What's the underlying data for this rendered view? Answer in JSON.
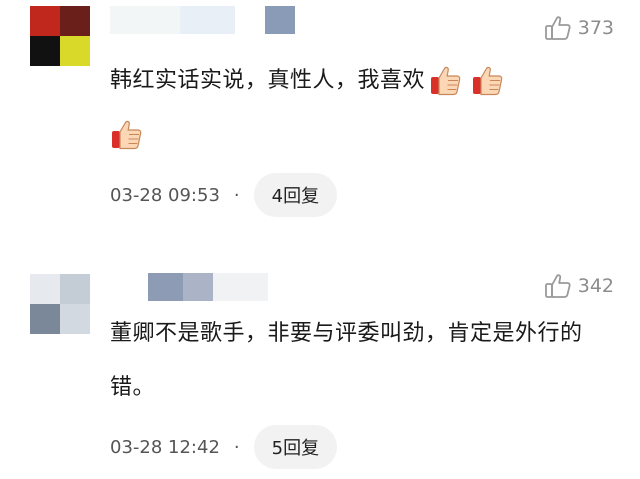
{
  "comments": [
    {
      "likes": "373",
      "text": "韩红实话实说，真性人，我喜欢",
      "time": "03-28 09:53",
      "dot": "·",
      "reply_label": "4回复"
    },
    {
      "likes": "342",
      "text": "董卿不是歌手，非要与评委叫劲，肯定是外行的错。",
      "time": "03-28 12:42",
      "dot": "·",
      "reply_label": "5回复"
    }
  ],
  "icons": {
    "like": "thumbs-up-outline-icon",
    "emoji": "thumbs-up-emoji-icon"
  },
  "colors": {
    "avatar1": [
      "#c0281e",
      "#6b1f1a",
      "#111111",
      "#d9d92a"
    ],
    "avatar2": [
      "#dfe3e8",
      "#b9c1cc",
      "#7a8899",
      "#9aa6b4"
    ],
    "username1": [
      "#eef3f5",
      "#e6eef6",
      "#8a9bb8"
    ],
    "username2": [
      "#8e9bb4",
      "#aab4c6",
      "#f1f2f4"
    ]
  }
}
